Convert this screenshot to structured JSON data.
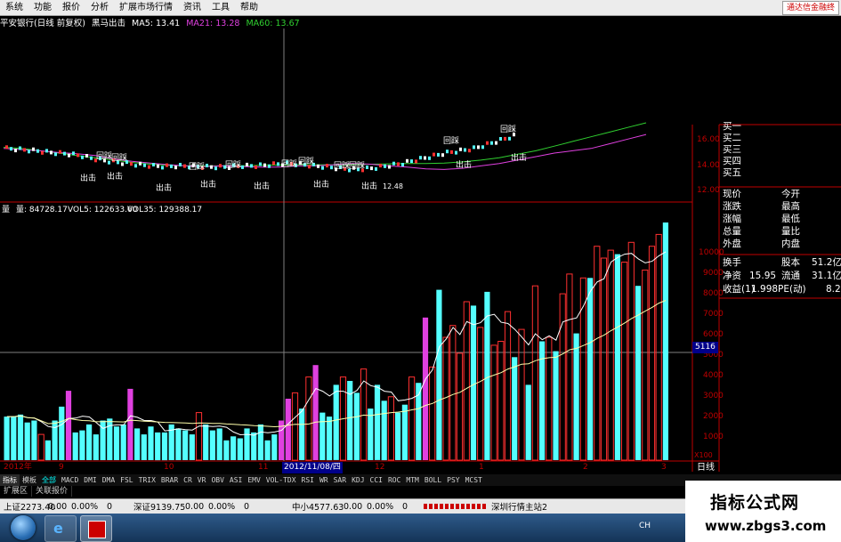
{
  "menu": [
    "系统",
    "功能",
    "报价",
    "分析",
    "扩展市场行情",
    "资讯",
    "工具",
    "帮助"
  ],
  "ad_text": "通达信金融终",
  "price_info": {
    "title": "平安银行(日线 前复权)",
    "indicator": "黑马出击",
    "ma5": "MA5: 13.41",
    "ma21": "MA21: 13.28",
    "ma60": "MA60: 13.67"
  },
  "price_axis": [
    "16.00",
    "14.00",
    "12.00"
  ],
  "signal_labels": {
    "chuji": "出击",
    "huidang": "回踩",
    "low_price": "12.48"
  },
  "volume_info": {
    "label": "量",
    "vol": "量: 84728.17",
    "vol5": "VOL5: 122633.60",
    "vol35": "VOL35: 129388.17"
  },
  "volume_axis": [
    "10000",
    "9000",
    "8000",
    "7000",
    "6000",
    "5000",
    "4000",
    "3000",
    "2000",
    "1000",
    "X100"
  ],
  "crosshair_value": "5116",
  "date_axis": [
    "2012年",
    "9",
    "10",
    "11",
    "12",
    "1",
    "2",
    "3"
  ],
  "crosshair_date": "2012/11/08/四",
  "period_label": "日线",
  "right_panel": {
    "buy_levels": [
      "买一",
      "买二",
      "买三",
      "买四",
      "买五"
    ],
    "quote_rows": [
      {
        "l1": "现价",
        "l2": "今开"
      },
      {
        "l1": "涨跌",
        "l2": "最高"
      },
      {
        "l1": "涨幅",
        "l2": "最低"
      },
      {
        "l1": "总量",
        "l2": "量比"
      },
      {
        "l1": "外盘",
        "l2": "内盘"
      }
    ],
    "stat_rows": [
      {
        "l1": "换手",
        "v1": "",
        "l2": "股本",
        "v2": "51.2亿"
      },
      {
        "l1": "净资",
        "v1": "15.95",
        "l2": "流通",
        "v2": "31.1亿"
      },
      {
        "l1": "收益(1)",
        "v1": "1.998",
        "l2": "PE(动)",
        "v2": "8.2"
      }
    ]
  },
  "indicator_tabs": [
    "指标",
    "模板",
    "全部",
    "MACD",
    "DMI",
    "DMA",
    "FSL",
    "TRIX",
    "BRAR",
    "CR",
    "VR",
    "OBV",
    "ASI",
    "EMV",
    "VOL-TDX",
    "RSI",
    "WR",
    "SAR",
    "KDJ",
    "CCI",
    "ROC",
    "MTM",
    "BOLL",
    "PSY",
    "MCST"
  ],
  "extra_tabs": [
    "扩展区",
    "关联报价"
  ],
  "ticker": {
    "sh": "上证2273.40",
    "sh_chg": "0.00",
    "sh_pct": "0.00%",
    "sh_val": "0",
    "sz": "深证9139.75",
    "sz_chg": "0.00",
    "sz_pct": "0.00%",
    "sz_val": "0",
    "zx": "中小4577.63",
    "zx_chg": "0.00",
    "zx_pct": "0.00%",
    "zx_val": "0",
    "station": "深圳行情主站2",
    "flag": "CH"
  },
  "watermark": {
    "line1": "指标公式网",
    "line2": "www.zbgs3.com"
  },
  "colors": {
    "up": "#ff3030",
    "down": "#54ffff",
    "magenta": "#e040e0",
    "axis": "#c00000",
    "ma5": "#ffffff",
    "ma21": "#e040e0",
    "ma60": "#30d030"
  },
  "chart_data": {
    "type": "bar",
    "volume_series": {
      "name": "量",
      "values": [
        22,
        22,
        23,
        19,
        20,
        13,
        10,
        20,
        27,
        35,
        14,
        15,
        18,
        13,
        20,
        21,
        17,
        18,
        36,
        16,
        13,
        17,
        14,
        14,
        18,
        16,
        15,
        13,
        24,
        18,
        15,
        16,
        10,
        12,
        11,
        16,
        14,
        18,
        10,
        13,
        20,
        31,
        34,
        26,
        42,
        48,
        24,
        22,
        38,
        42,
        40,
        34,
        46,
        26,
        38,
        30,
        32,
        24,
        28,
        42,
        39,
        72,
        47,
        86,
        62,
        68,
        54,
        80,
        78,
        67,
        85,
        58,
        60,
        75,
        52,
        66,
        38,
        88,
        60,
        62,
        55,
        84,
        94,
        64,
        92,
        92,
        108,
        102,
        106,
        104,
        100,
        110,
        88,
        96,
        108,
        114,
        120
      ],
      "colors": [
        "d",
        "d",
        "d",
        "d",
        "d",
        "r",
        "d",
        "d",
        "d",
        "m",
        "d",
        "d",
        "d",
        "d",
        "d",
        "d",
        "d",
        "d",
        "m",
        "d",
        "d",
        "d",
        "d",
        "d",
        "d",
        "d",
        "d",
        "d",
        "r",
        "d",
        "d",
        "d",
        "d",
        "d",
        "d",
        "d",
        "d",
        "d",
        "d",
        "d",
        "m",
        "m",
        "r",
        "d",
        "r",
        "m",
        "d",
        "d",
        "d",
        "r",
        "d",
        "d",
        "r",
        "d",
        "d",
        "d",
        "r",
        "d",
        "d",
        "r",
        "d",
        "m",
        "r",
        "d",
        "r",
        "r",
        "r",
        "r",
        "d",
        "r",
        "d",
        "r",
        "r",
        "r",
        "d",
        "r",
        "d",
        "r",
        "d",
        "r",
        "d",
        "r",
        "r",
        "d",
        "r",
        "d",
        "r",
        "r",
        "r",
        "d",
        "r",
        "r",
        "d",
        "r",
        "r",
        "r",
        "d"
      ],
      "unit": "X100",
      "ylim": [
        0,
        11000
      ]
    },
    "price_series": {
      "ma5": [
        14.8,
        14.7,
        14.6,
        14.45,
        14.35,
        14.2,
        13.9,
        13.7,
        13.55,
        13.4,
        13.3,
        13.25,
        13.3,
        13.25,
        13.2,
        13.2,
        13.3,
        13.3,
        13.4,
        13.5,
        13.45,
        13.3,
        13.2,
        13.05,
        13.0,
        13.1,
        13.3,
        13.5,
        13.8,
        14.1,
        14.4,
        14.6,
        14.8,
        15.2,
        15.6,
        16.0
      ],
      "ma60": [
        14.9,
        14.8,
        14.6,
        14.4,
        14.2,
        14.0,
        13.8,
        13.6,
        13.45,
        13.35,
        13.3,
        13.3,
        13.3,
        13.32,
        13.35,
        13.38,
        13.4,
        13.4,
        13.4,
        13.42,
        13.45,
        13.48,
        13.5,
        13.5,
        13.55,
        13.65,
        13.8,
        14.0,
        14.3,
        14.6,
        15.0,
        15.4,
        15.8,
        16.2,
        16.6,
        17.0
      ],
      "ylim": [
        11.5,
        17.0
      ]
    }
  }
}
